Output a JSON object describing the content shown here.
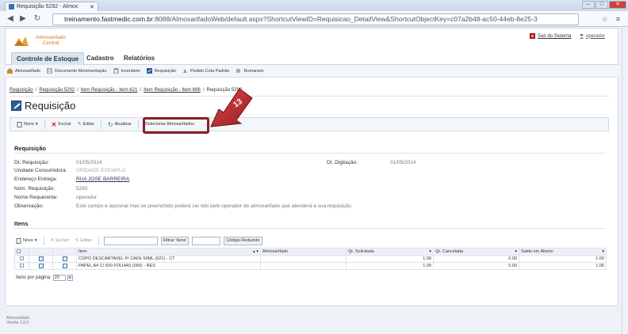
{
  "browser": {
    "tab_title": "Requisição 5292 - Almox",
    "url_host": "treinamento.fastmedic.com.br",
    "url_rest": ":8088/AlmoxarifadoWeb/default.aspx?ShortcutViewID=Requisicao_DetailView&ShortcutObjectKey=c07a2b48-ac50-44eb-8e25-3",
    "win_min": "–",
    "win_max": "□",
    "win_close": "✕",
    "back": "◀",
    "forward": "▶",
    "reload": "↻",
    "star": "☆",
    "settings": "≡"
  },
  "header": {
    "logo_line1": "Almoxarifado",
    "logo_line2": "Central",
    "signout": "Sair do Sistema",
    "user": "operador"
  },
  "main_tabs": [
    "Controle de Estoque",
    "Cadastro",
    "Relatórios"
  ],
  "subnav": [
    "Almoxarifado",
    "Documento Movimentação",
    "Inventário",
    "Requisição",
    "Pedido Cota Padrão",
    "Romaneio"
  ],
  "breadcrumb": [
    "Requisição",
    "Requisição 5292",
    "Item Requisição - Item 621",
    "Item Requisição - Item 666",
    "Requisição 5292"
  ],
  "page_title": "Requisição",
  "toolbar": {
    "new": "Novo",
    "delete": "Excluir",
    "edit": "Editar",
    "refresh": "Atualizar",
    "select_stock": "Selecionar Almoxarifados"
  },
  "callout": "13",
  "requisicao": {
    "section": "Requisição",
    "labels": {
      "dt_req": "Dt. Requisição:",
      "unidade": "Unidade Consumidora:",
      "endereco": "Endereço Entrega:",
      "num": "Núm. Requisição:",
      "nome": "Nome Requerente:",
      "obs": "Observação:",
      "dt_dig": "Dt. Digitação:"
    },
    "values": {
      "dt_req": "01/05/2014",
      "unidade": "UNIDADE EXEMPLO",
      "endereco": "RUA JOSE BARREIRA",
      "num": "5292",
      "nome": "operador",
      "obs": "Este campo é opcional mas se preenchido poderá ser lido pelo operador de almoxarifado que atenderá a sua requisição.",
      "dt_dig": "01/05/2014"
    }
  },
  "itens": {
    "section": "Itens",
    "toolbar": {
      "new": "Novo",
      "delete": "Excluir",
      "edit": "Editar",
      "filter_btn": "Filtrar 'Itens'",
      "reduced_code": "Código Reduzido"
    },
    "columns": [
      "Item",
      "Almoxarifado",
      "Qt. Solicitada",
      "Qt. Cancelada",
      "Saldo em Aberto"
    ],
    "rows": [
      {
        "item": "COPO DESCARTAVEL P/ CAFE 50ML (621) - CT",
        "almox": "",
        "qt_sol": "1.00",
        "qt_can": "0.00",
        "saldo": "1.00"
      },
      {
        "item": "PAPEL A4 C/ 500 FOLHAS (666) - RES",
        "almox": "",
        "qt_sol": "1.00",
        "qt_can": "0.00",
        "saldo": "1.00"
      }
    ],
    "pager_label": "Itens por página:",
    "pager_value": "20"
  },
  "footer": {
    "app": "Almoxarifado",
    "version": "Versão 1.0.0"
  }
}
